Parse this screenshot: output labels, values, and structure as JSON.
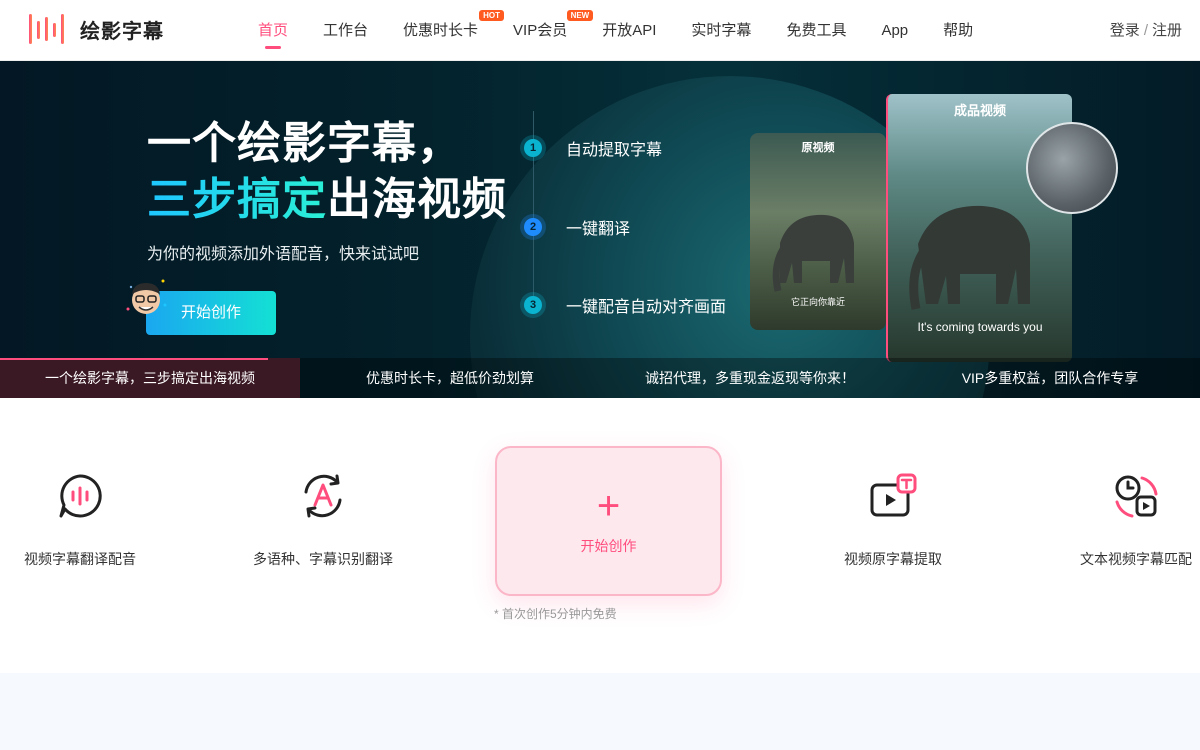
{
  "brand": {
    "name": "绘影字幕"
  },
  "nav": {
    "items": [
      {
        "label": "首页",
        "active": true
      },
      {
        "label": "工作台"
      },
      {
        "label": "优惠时长卡",
        "badge": "HOT"
      },
      {
        "label": "VIP会员",
        "badge": "NEW"
      },
      {
        "label": "开放API"
      },
      {
        "label": "实时字幕"
      },
      {
        "label": "免费工具"
      },
      {
        "label": "App"
      },
      {
        "label": "帮助"
      }
    ],
    "login": "登录",
    "separator": "/",
    "register": "注册"
  },
  "hero": {
    "title_line1": "一个绘影字幕，",
    "title_line2_highlight": "三步搞定",
    "title_line2_rest": "出海视频",
    "subtitle": "为你的视频添加外语配音，快来试试吧",
    "cta": "开始创作",
    "steps": [
      {
        "num": "1",
        "label": "自动提取字幕"
      },
      {
        "num": "2",
        "label": "一键翻译"
      },
      {
        "num": "3",
        "label": "一键配音自动对齐画面"
      }
    ],
    "source_card": {
      "label": "原视频",
      "caption": "它正向你靠近"
    },
    "result_card": {
      "label": "成品视频",
      "caption": "It's coming towards you"
    }
  },
  "banner_tabs": [
    {
      "label": "一个绘影字幕，三步搞定出海视频",
      "active": true
    },
    {
      "label": "优惠时长卡，超低价劲划算"
    },
    {
      "label": "诚招代理，多重现金返现等你来！"
    },
    {
      "label": "VIP多重权益，团队合作专享"
    }
  ],
  "features": [
    {
      "icon": "speech-bubble-icon",
      "label": "视频字幕翻译配音"
    },
    {
      "icon": "translate-refresh-icon",
      "label": "多语种、字幕识别翻译"
    },
    {
      "icon": "video-text-icon",
      "label": "视频原字幕提取"
    },
    {
      "icon": "clock-play-icon",
      "label": "文本视频字幕匹配"
    }
  ],
  "create": {
    "label": "开始创作",
    "note": "* 首次创作5分钟内免费"
  },
  "colors": {
    "accent": "#ff4d7d",
    "hero_bg": "#031824",
    "cta_start": "#1aa7f0",
    "cta_end": "#14e0d4"
  }
}
